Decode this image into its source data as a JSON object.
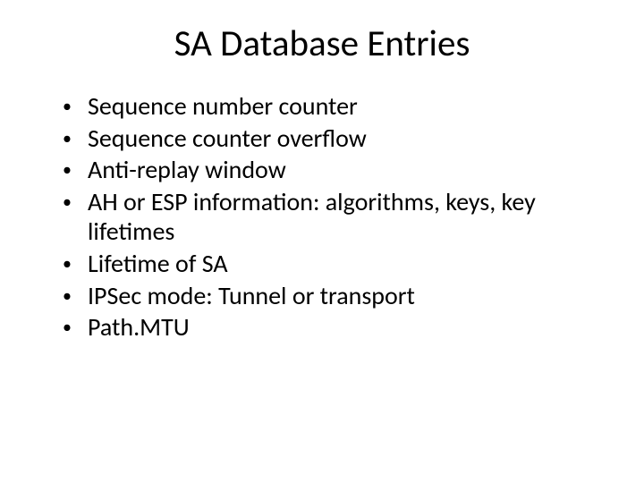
{
  "title": "SA Database Entries",
  "bullets": [
    "Sequence number counter",
    "Sequence counter overflow",
    "Anti-replay window",
    "AH or ESP information: algorithms, keys, key lifetimes",
    "Lifetime of SA",
    "IPSec mode: Tunnel or transport",
    "Path.MTU"
  ]
}
